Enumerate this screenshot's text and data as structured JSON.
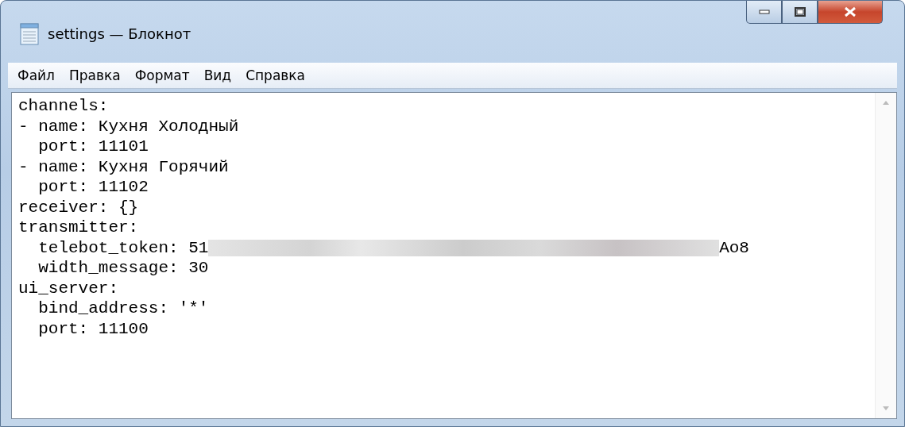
{
  "window": {
    "title": "settings — Блокнот"
  },
  "menu": [
    "Файл",
    "Правка",
    "Формат",
    "Вид",
    "Справка"
  ],
  "lines": [
    [
      {
        "kind": "text",
        "text": "channels:"
      }
    ],
    [
      {
        "kind": "text",
        "text": "- name: Кухня Холодный"
      }
    ],
    [
      {
        "kind": "text",
        "text": "  port: 11101"
      }
    ],
    [
      {
        "kind": "text",
        "text": "- name: Кухня Горячий"
      }
    ],
    [
      {
        "kind": "text",
        "text": "  port: 11102"
      }
    ],
    [
      {
        "kind": "text",
        "text": "receiver: {}"
      }
    ],
    [
      {
        "kind": "text",
        "text": "transmitter:"
      }
    ],
    [
      {
        "kind": "text",
        "text": "  telebot_token: 51"
      },
      {
        "kind": "blur"
      },
      {
        "kind": "text",
        "text": "Ao8"
      }
    ],
    [
      {
        "kind": "text",
        "text": "  width_message: 30"
      }
    ],
    [
      {
        "kind": "text",
        "text": "ui_server:"
      }
    ],
    [
      {
        "kind": "text",
        "text": "  bind_address: '*'"
      }
    ],
    [
      {
        "kind": "text",
        "text": "  port: 11100"
      }
    ]
  ]
}
